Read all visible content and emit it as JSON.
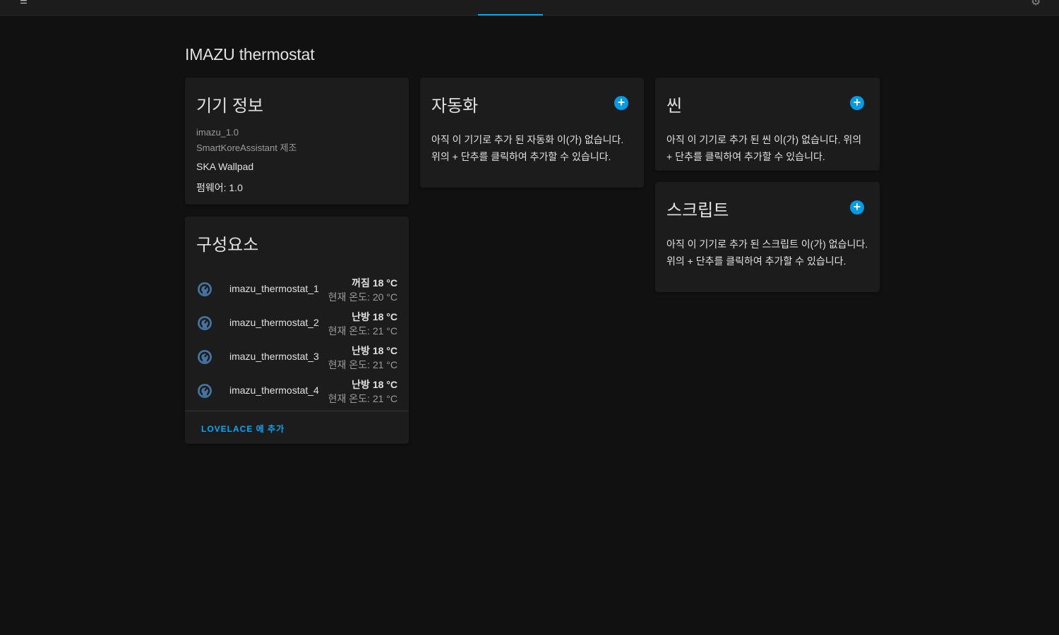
{
  "page": {
    "title": "IMAZU thermostat"
  },
  "topbar": {
    "menu_icon": "menu-icon",
    "settings_icon": "gear-icon",
    "accent": "#03a9f4"
  },
  "device_info": {
    "title": "기기 정보",
    "model": "imazu_1.0",
    "manufacturer": "SmartKoreAssistant 제조",
    "name": "SKA Wallpad",
    "firmware": "펌웨어: 1.0"
  },
  "components": {
    "title": "구성요소",
    "entities": [
      {
        "name": "imazu_thermostat_1",
        "state": "꺼짐 18 °C",
        "current": "현재 온도: 20 °C",
        "icon": "thermostat-icon"
      },
      {
        "name": "imazu_thermostat_2",
        "state": "난방 18 °C",
        "current": "현재 온도: 21 °C",
        "icon": "thermostat-icon"
      },
      {
        "name": "imazu_thermostat_3",
        "state": "난방 18 °C",
        "current": "현재 온도: 21 °C",
        "icon": "thermostat-icon"
      },
      {
        "name": "imazu_thermostat_4",
        "state": "난방 18 °C",
        "current": "현재 온도: 21 °C",
        "icon": "thermostat-icon"
      }
    ],
    "add_to_lovelace": "LOVELACE 에 추가"
  },
  "automation": {
    "title": "자동화",
    "empty": "아직 이 기기로 추가 된 자동화 이(가) 없습니다. 위의 + 단추를 클릭하여 추가할 수 있습니다."
  },
  "scene": {
    "title": "씬",
    "empty": "아직 이 기기로 추가 된 씬 이(가) 없습니다. 위의 + 단추를 클릭하여 추가할 수 있습니다."
  },
  "script": {
    "title": "스크립트",
    "empty": "아직 이 기기로 추가 된 스크립트 이(가) 없습니다. 위의 + 단추를 클릭하여 추가할 수 있습니다."
  },
  "add_label": "+"
}
